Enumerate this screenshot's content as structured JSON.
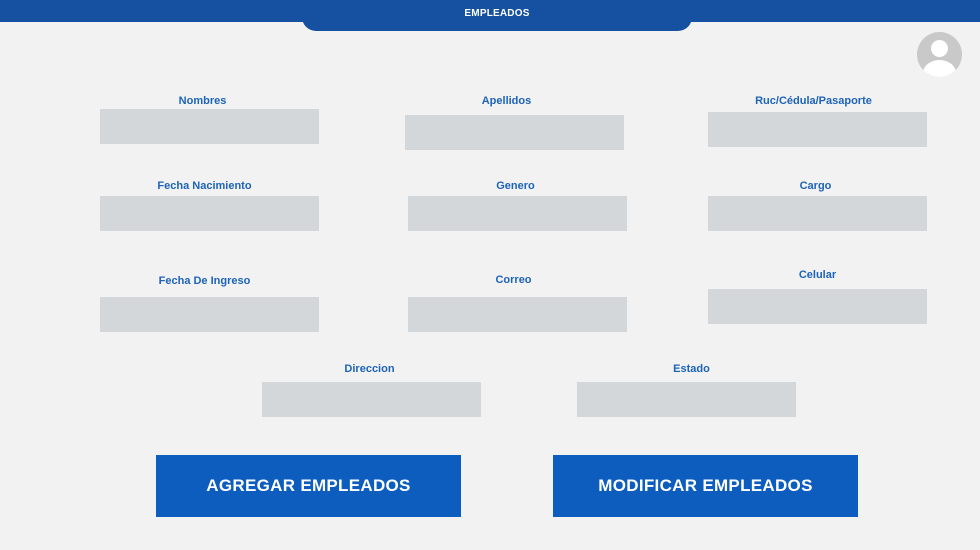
{
  "header": {
    "title": "EMPLEADOS",
    "avatar_icon": "user-avatar-icon"
  },
  "form": {
    "nombres": {
      "label": "Nombres",
      "value": ""
    },
    "apellidos": {
      "label": "Apellidos",
      "value": ""
    },
    "ruc": {
      "label": "Ruc/Cédula/Pasaporte",
      "value": ""
    },
    "fecha_nacimiento": {
      "label": "Fecha Nacimiento",
      "value": ""
    },
    "genero": {
      "label": "Genero",
      "value": ""
    },
    "cargo": {
      "label": "Cargo",
      "value": ""
    },
    "fecha_ingreso": {
      "label": "Fecha De Ingreso",
      "value": ""
    },
    "correo": {
      "label": "Correo",
      "value": ""
    },
    "celular": {
      "label": "Celular",
      "value": ""
    },
    "direccion": {
      "label": "Direccion",
      "value": ""
    },
    "estado": {
      "label": "Estado",
      "value": ""
    }
  },
  "actions": {
    "agregar_label": "AGREGAR EMPLEADOS",
    "modificar_label": "MODIFICAR EMPLEADOS"
  },
  "colors": {
    "header": "#1650a0",
    "label": "#1d63b8",
    "field": "#d3d7da",
    "button": "#0c5dbd",
    "background": "#f2f2f2"
  }
}
